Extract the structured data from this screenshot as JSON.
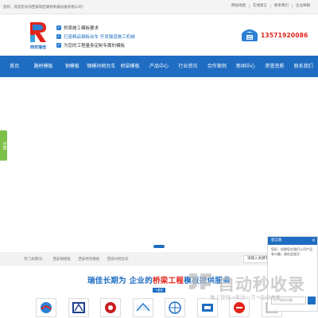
{
  "topbar": {
    "welcome": "您好，欢迎您访问西安瑞佳路桥机械设备有限公司！",
    "links": [
      "网站地图",
      "在线留言",
      "联系我们",
      "企业邮箱"
    ]
  },
  "header": {
    "logo_text": "西安瑞佳",
    "slogans": [
      {
        "text": "桥梁施工模板要求"
      },
      {
        "text": "打造精品钢板台车 开发隧道施工机械"
      },
      {
        "text": "为您的工程量身定制专属的模板"
      }
    ],
    "phone": "13571920086"
  },
  "nav": {
    "items": [
      "首页",
      "路桥模板",
      "钢模板",
      "钢模衬砌台车",
      "桥梁模板",
      "产品中心",
      "行业资讯",
      "合作案例",
      "新闻中心",
      "荣誉资质",
      "联系我们"
    ]
  },
  "share_tab": "分享",
  "hotsearch": {
    "label": "热门关键词：",
    "keywords": [
      "西安钢模板",
      "西安桥梁模板",
      "西安衬砌台车"
    ],
    "placeholder": "请输入关键字"
  },
  "section": {
    "title_main": "瑞佳长期为 企业的",
    "title_highlight": "桥梁工程",
    "title_rest": "模板提供服务",
    "more": "+更多"
  },
  "partners": [
    "partner-logo-1",
    "partner-logo-2",
    "partner-logo-3",
    "partner-logo-4",
    "partner-logo-5",
    "partner-logo-6",
    "partner-logo-7",
    "partner-logo-8"
  ],
  "consult": {
    "title": "留言板",
    "message": "您好，如果您对我们公司产品有兴趣，请在此留言",
    "input_placeholder": "写下您的问题"
  },
  "watermark": {
    "text": "自动秒收录",
    "sub": "做上链接→来访一次→自动收录"
  },
  "colors": {
    "brand_blue": "#1f6dc2",
    "phone_red": "#e2231a",
    "share_green": "#7cc24a"
  }
}
